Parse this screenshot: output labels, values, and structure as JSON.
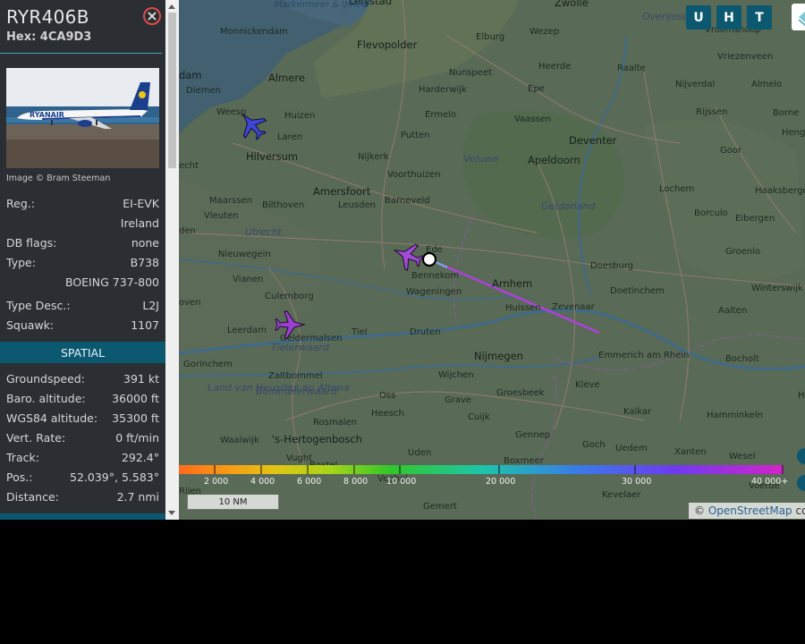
{
  "sidebar": {
    "callsign": "RYR406B",
    "hex": "Hex: 4CA9D3",
    "photo_credit": "Image © Bram Steeman",
    "photo_logo": "RYANAIR",
    "rows": [
      {
        "key": "Reg.:",
        "value": "EI-EVK"
      },
      {
        "key": "",
        "value": "Ireland"
      },
      {
        "key": "DB flags:",
        "value": "none"
      },
      {
        "key": "Type:",
        "value": "B738"
      },
      {
        "key": "",
        "value": "BOEING 737-800"
      },
      {
        "key": "Type Desc.:",
        "value": "L2J"
      },
      {
        "key": "Squawk:",
        "value": "1107"
      }
    ],
    "section_title": "SPATIAL",
    "spatial": [
      {
        "key": "Groundspeed:",
        "value": "391 kt"
      },
      {
        "key": "Baro. altitude:",
        "value": "36000 ft"
      },
      {
        "key": "WGS84 altitude:",
        "value": "35300 ft"
      },
      {
        "key": "Vert. Rate:",
        "value": "0 ft/min"
      },
      {
        "key": "Track:",
        "value": "292.4°"
      },
      {
        "key": "Pos.:",
        "value": "52.039°, 5.583°"
      },
      {
        "key": "Distance:",
        "value": "2.7 nmi"
      }
    ]
  },
  "map": {
    "buttons": [
      "U",
      "H",
      "T"
    ],
    "scale": "10 NM",
    "attribution_symbol": "©",
    "attribution_link": "OpenStreetMap",
    "attribution_tail": "cor",
    "altitude_labels": [
      "2 000",
      "4 000",
      "6 000",
      "8 000",
      "10 000",
      "20 000",
      "30 000",
      "40 000+"
    ],
    "places": [
      {
        "name": "Lelystad",
        "cls": "big"
      },
      {
        "name": "Zwolle",
        "cls": "big"
      },
      {
        "name": "Overijssel",
        "cls": "region"
      },
      {
        "name": "Vroomshoop",
        "cls": ""
      },
      {
        "name": "Monnickendam",
        "cls": ""
      },
      {
        "name": "Flevopolder",
        "cls": "big"
      },
      {
        "name": "Elburg",
        "cls": ""
      },
      {
        "name": "Wezep",
        "cls": ""
      },
      {
        "name": "Vriezenveen",
        "cls": ""
      },
      {
        "name": "Almere",
        "cls": "big"
      },
      {
        "name": "Nunspeet",
        "cls": ""
      },
      {
        "name": "Heerde",
        "cls": ""
      },
      {
        "name": "Raalte",
        "cls": ""
      },
      {
        "name": "Nijverdal",
        "cls": ""
      },
      {
        "name": "Almelo",
        "cls": ""
      },
      {
        "name": "Diemen",
        "cls": ""
      },
      {
        "name": "Harderwijk",
        "cls": ""
      },
      {
        "name": "Epe",
        "cls": ""
      },
      {
        "name": "Weesp",
        "cls": ""
      },
      {
        "name": "Huizen",
        "cls": ""
      },
      {
        "name": "Ermelo",
        "cls": ""
      },
      {
        "name": "Vaassen",
        "cls": ""
      },
      {
        "name": "Rijssen",
        "cls": ""
      },
      {
        "name": "Borne",
        "cls": ""
      },
      {
        "name": "Laren",
        "cls": ""
      },
      {
        "name": "Putten",
        "cls": ""
      },
      {
        "name": "Deventer",
        "cls": "big"
      },
      {
        "name": "Hengelo",
        "cls": ""
      },
      {
        "name": "Hilversum",
        "cls": "big"
      },
      {
        "name": "Nijkerk",
        "cls": ""
      },
      {
        "name": "Veluwe",
        "cls": "region"
      },
      {
        "name": "Apeldoorn",
        "cls": "big"
      },
      {
        "name": "Goor",
        "cls": ""
      },
      {
        "name": "Voorthuizen",
        "cls": ""
      },
      {
        "name": "Amersfoort",
        "cls": "big"
      },
      {
        "name": "Lochem",
        "cls": ""
      },
      {
        "name": "Haaksbergen",
        "cls": ""
      },
      {
        "name": "Maarssen",
        "cls": ""
      },
      {
        "name": "Bilthoven",
        "cls": ""
      },
      {
        "name": "Leusden",
        "cls": ""
      },
      {
        "name": "Barneveld",
        "cls": ""
      },
      {
        "name": "Gelderland",
        "cls": "region"
      },
      {
        "name": "Vleuten",
        "cls": ""
      },
      {
        "name": "Borculo",
        "cls": ""
      },
      {
        "name": "Eibergen",
        "cls": ""
      },
      {
        "name": "Utrecht",
        "cls": "region"
      },
      {
        "name": "Ede",
        "cls": ""
      },
      {
        "name": "Groenlo",
        "cls": ""
      },
      {
        "name": "Nieuwegein",
        "cls": ""
      },
      {
        "name": "Doesburg",
        "cls": ""
      },
      {
        "name": "Bennekom",
        "cls": ""
      },
      {
        "name": "Arnhem",
        "cls": "big"
      },
      {
        "name": "Vianen",
        "cls": ""
      },
      {
        "name": "Wageningen",
        "cls": ""
      },
      {
        "name": "Doetinchem",
        "cls": ""
      },
      {
        "name": "Winterswijk",
        "cls": ""
      },
      {
        "name": "Culemborg",
        "cls": ""
      },
      {
        "name": "Huissen",
        "cls": ""
      },
      {
        "name": "Zevenaar",
        "cls": ""
      },
      {
        "name": "Aalten",
        "cls": ""
      },
      {
        "name": "Leerdam",
        "cls": ""
      },
      {
        "name": "Tiel",
        "cls": ""
      },
      {
        "name": "Druten",
        "cls": ""
      },
      {
        "name": "Geldermalsen",
        "cls": ""
      },
      {
        "name": "Tielerwaard",
        "cls": "region"
      },
      {
        "name": "Nijmegen",
        "cls": "big"
      },
      {
        "name": "Emmerich am Rhein",
        "cls": ""
      },
      {
        "name": "Bocholt",
        "cls": ""
      },
      {
        "name": "Gorinchem",
        "cls": ""
      },
      {
        "name": "Zaltbommel",
        "cls": ""
      },
      {
        "name": "Wijchen",
        "cls": ""
      },
      {
        "name": "Kleve",
        "cls": ""
      },
      {
        "name": "Land van Heusden en Altena",
        "cls": "region"
      },
      {
        "name": "Bommelerwaard",
        "cls": "region"
      },
      {
        "name": "Groesbeek",
        "cls": ""
      },
      {
        "name": "Oss",
        "cls": ""
      },
      {
        "name": "Grave",
        "cls": ""
      },
      {
        "name": "Heesch",
        "cls": ""
      },
      {
        "name": "Cuijk",
        "cls": ""
      },
      {
        "name": "Kalkar",
        "cls": ""
      },
      {
        "name": "Hamminkeln",
        "cls": ""
      },
      {
        "name": "Rosmalen",
        "cls": ""
      },
      {
        "name": "Gennep",
        "cls": ""
      },
      {
        "name": "Waalwijk",
        "cls": ""
      },
      {
        "name": "'s-Hertogenbosch",
        "cls": "big"
      },
      {
        "name": "Goch",
        "cls": ""
      },
      {
        "name": "Uedem",
        "cls": ""
      },
      {
        "name": "Xanten",
        "cls": ""
      },
      {
        "name": "Uden",
        "cls": ""
      },
      {
        "name": "Wesel",
        "cls": ""
      },
      {
        "name": "Vught",
        "cls": ""
      },
      {
        "name": "Boxmeer",
        "cls": ""
      },
      {
        "name": "Boxtel",
        "cls": ""
      },
      {
        "name": "Veghel",
        "cls": ""
      },
      {
        "name": "Kevelaer",
        "cls": ""
      },
      {
        "name": "Voerde",
        "cls": ""
      },
      {
        "name": "Gemert",
        "cls": ""
      },
      {
        "name": "Rijen",
        "cls": ""
      },
      {
        "name": "Markermeer & IJmeer",
        "cls": "water"
      },
      {
        "name": "dam",
        "cls": "big"
      },
      {
        "name": "echt",
        "cls": ""
      },
      {
        "name": "den",
        "cls": ""
      },
      {
        "name": "oven",
        "cls": ""
      },
      {
        "name": "Hat",
        "cls": ""
      }
    ]
  }
}
